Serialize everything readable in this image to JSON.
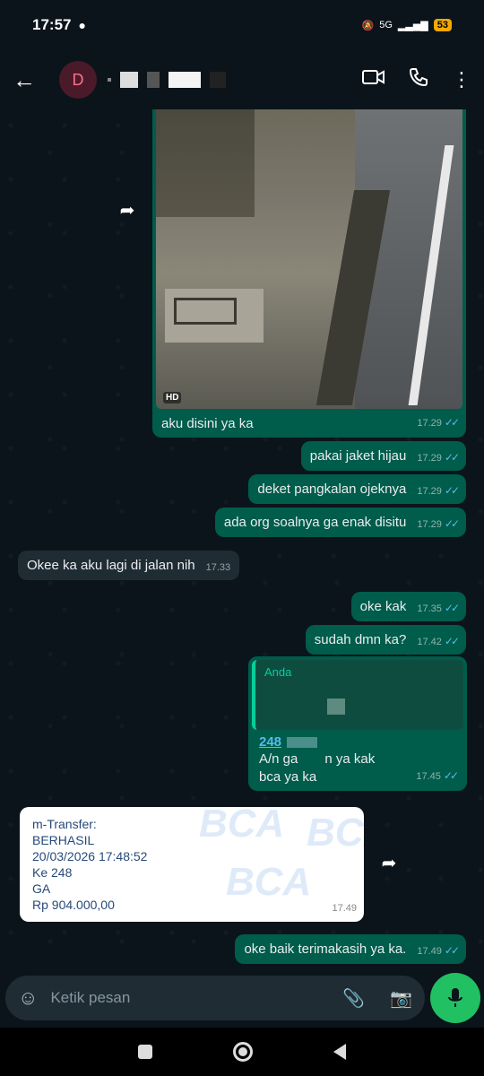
{
  "status_bar": {
    "time": "17:57",
    "network": "5G",
    "battery": "53"
  },
  "header": {
    "avatar_letter": "D"
  },
  "photo_message": {
    "hd_badge": "HD",
    "caption": "aku disini ya ka",
    "time": "17.29"
  },
  "messages": [
    {
      "text": "pakai jaket hijau",
      "time": "17.29",
      "direction": "out"
    },
    {
      "text": "deket pangkalan ojeknya",
      "time": "17.29",
      "direction": "out"
    },
    {
      "text": "ada org soalnya ga enak disitu",
      "time": "17.29",
      "direction": "out"
    },
    {
      "text": "Okee ka aku lagi di jalan nih",
      "time": "17.33",
      "direction": "in"
    },
    {
      "text": "oke kak",
      "time": "17.35",
      "direction": "out"
    },
    {
      "text": "sudah dmn ka?",
      "time": "17.42",
      "direction": "out"
    }
  ],
  "reply_message": {
    "quote_author": "Anda",
    "account_prefix": "248",
    "line2_start": "A/n ga",
    "line2_end": "n ya kak",
    "line3": "bca ya ka",
    "time": "17.45"
  },
  "receipt": {
    "lines": [
      "m-Transfer:",
      "BERHASIL",
      "20/03/2026 17:48:52",
      "Ke 248",
      "GA",
      "Rp 904.000,00"
    ],
    "watermark": "BCA",
    "time": "17.49"
  },
  "last_message": {
    "text": "oke baik terimakasih ya ka.",
    "time": "17.49"
  },
  "input": {
    "placeholder": "Ketik pesan"
  },
  "ticks": "✓✓"
}
